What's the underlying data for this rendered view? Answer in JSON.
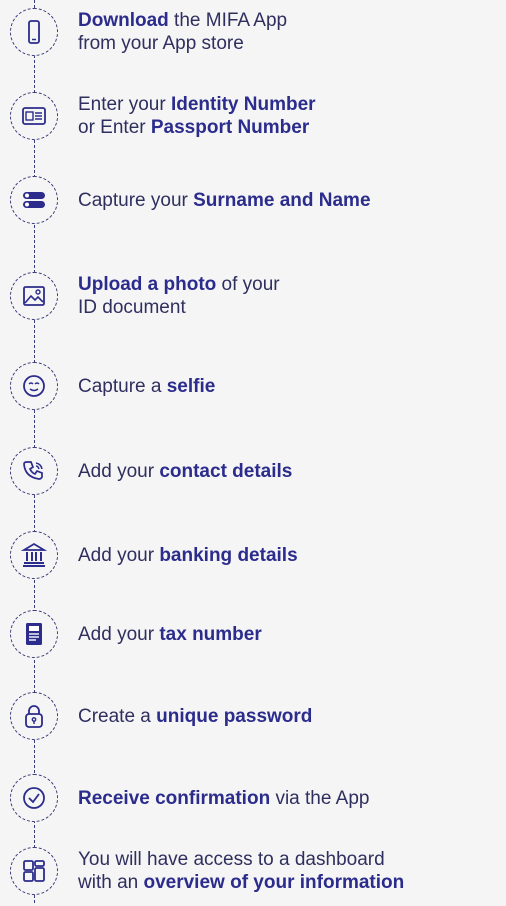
{
  "steps": [
    {
      "id": "download",
      "icon": "phone-icon",
      "parts": [
        {
          "b": "Download"
        },
        {
          "t": " the MIFA App"
        },
        {
          "br": true
        },
        {
          "t": "from your App store"
        }
      ]
    },
    {
      "id": "identity",
      "icon": "id-card-icon",
      "parts": [
        {
          "t": "Enter your "
        },
        {
          "b": "Identity Number"
        },
        {
          "br": true
        },
        {
          "t": "or Enter "
        },
        {
          "b": "Passport Number"
        }
      ]
    },
    {
      "id": "name",
      "icon": "name-cards-icon",
      "parts": [
        {
          "t": "Capture your "
        },
        {
          "b": "Surname and Name"
        }
      ]
    },
    {
      "id": "photo",
      "icon": "image-icon",
      "parts": [
        {
          "b": "Upload a photo"
        },
        {
          "t": " of your"
        },
        {
          "br": true
        },
        {
          "t": "ID document"
        }
      ]
    },
    {
      "id": "selfie",
      "icon": "smiley-face-icon",
      "parts": [
        {
          "t": "Capture a "
        },
        {
          "b": "selfie"
        }
      ]
    },
    {
      "id": "contact",
      "icon": "phone-call-icon",
      "parts": [
        {
          "t": "Add your "
        },
        {
          "b": "contact details"
        }
      ]
    },
    {
      "id": "banking",
      "icon": "bank-icon",
      "parts": [
        {
          "t": "Add your "
        },
        {
          "b": "banking details"
        }
      ]
    },
    {
      "id": "tax",
      "icon": "tax-document-icon",
      "parts": [
        {
          "t": "Add your "
        },
        {
          "b": "tax number"
        }
      ]
    },
    {
      "id": "password",
      "icon": "lock-icon",
      "parts": [
        {
          "t": "Create a "
        },
        {
          "b": "unique password"
        }
      ]
    },
    {
      "id": "confirmation",
      "icon": "check-circle-icon",
      "parts": [
        {
          "b": "Receive confirmation"
        },
        {
          "t": " via the App"
        }
      ]
    },
    {
      "id": "dashboard",
      "icon": "dashboard-icon",
      "parts": [
        {
          "t": "You will have access to a dashboard"
        },
        {
          "br": true
        },
        {
          "t": "with an "
        },
        {
          "b": "overview of your information"
        }
      ]
    }
  ]
}
